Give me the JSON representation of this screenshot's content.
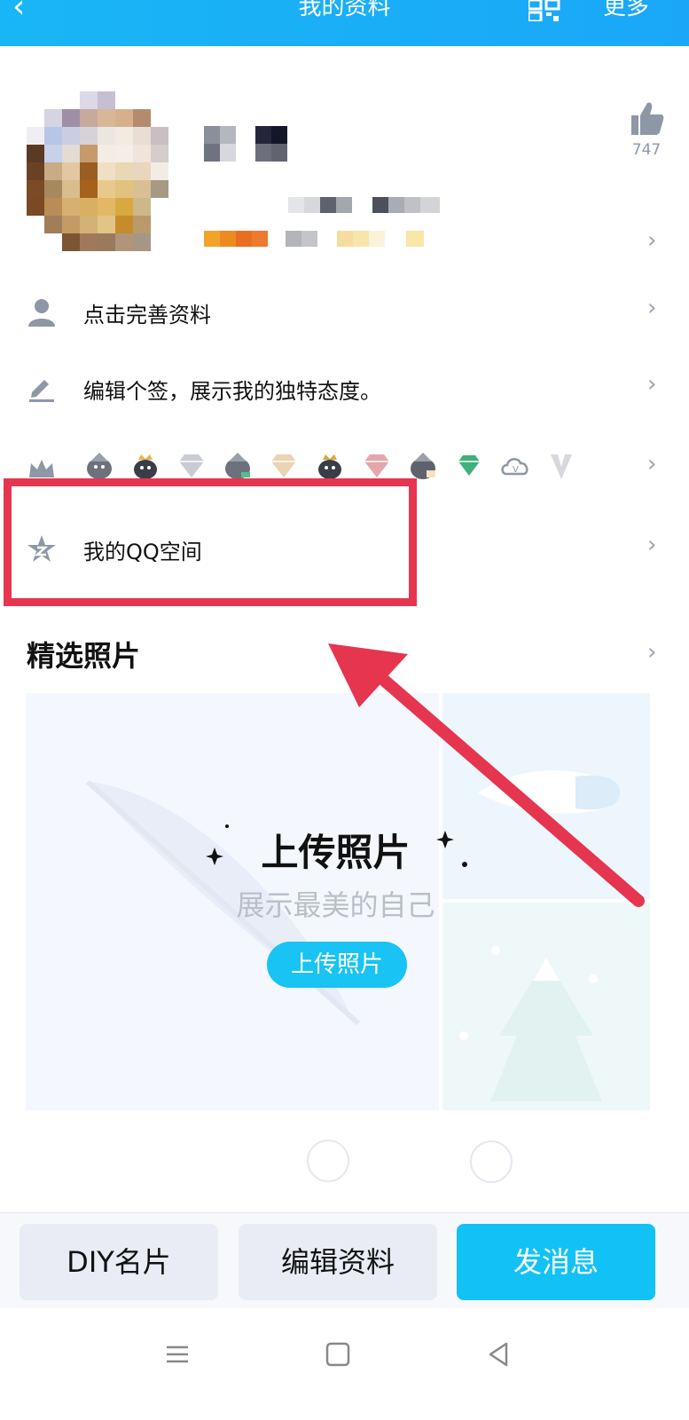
{
  "header": {
    "back_glyph": "‹",
    "title": "我的资料",
    "qr_icon": "qrcode-icon",
    "more_label": "更多"
  },
  "profile": {
    "like_count": "747"
  },
  "rows": [
    {
      "icon": "user-icon",
      "label": "点击完善资料"
    },
    {
      "icon": "pencil-icon",
      "label": "编辑个签，展示我的独特态度。"
    },
    {
      "icon": "crown-icon",
      "label": ""
    },
    {
      "icon": "star-icon",
      "label": "我的QQ空间"
    }
  ],
  "badges": [
    "penguin-badge",
    "penguin-crown-badge",
    "diamond-badge",
    "penguin-badge",
    "diamond-badge",
    "penguin-crown-badge",
    "diamond-badge",
    "penguin-badge",
    "green-diamond-badge",
    "cloud-v-badge",
    "v-badge"
  ],
  "photos": {
    "section_title": "精选照片",
    "upload_title": "上传照片",
    "upload_subtitle": "展示最美的自己",
    "upload_button": "上传照片"
  },
  "actions": {
    "diy": "DIY名片",
    "edit": "编辑资料",
    "message": "发消息"
  },
  "colors": {
    "accent": "#19c3f3",
    "highlight": "#e6364f",
    "header_bg": "#19b6f5"
  }
}
